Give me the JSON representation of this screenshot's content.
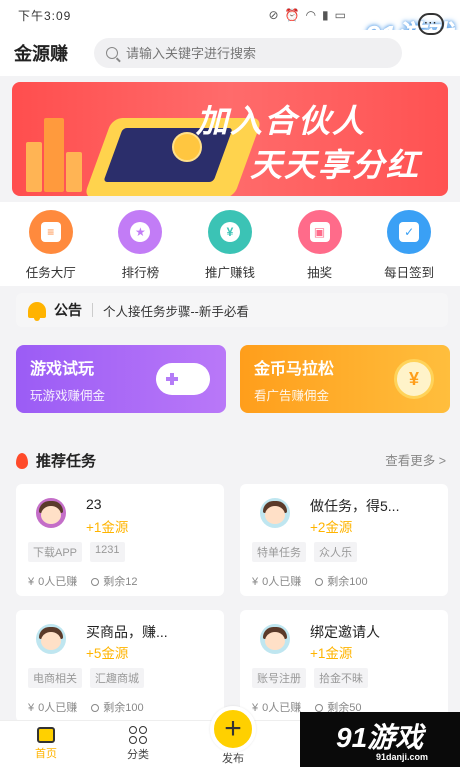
{
  "status_bar": {
    "time": "下午3:09"
  },
  "watermark": {
    "brand": "91游戏",
    "url": "91danji.com"
  },
  "header": {
    "app_title": "金源赚",
    "search_placeholder": "请输入关键字进行搜索"
  },
  "banner": {
    "line1": "加入合伙人",
    "line2": "天天享分红"
  },
  "quick_nav": [
    {
      "label": "任务大厅",
      "icon": "task-hall-icon",
      "color": "#ff8a3d"
    },
    {
      "label": "排行榜",
      "icon": "ranking-icon",
      "color": "#c27cf6"
    },
    {
      "label": "推广赚钱",
      "icon": "promote-money-icon",
      "color": "#3bc3b5"
    },
    {
      "label": "抽奖",
      "icon": "lottery-gift-icon",
      "color": "#ff6b8a"
    },
    {
      "label": "每日签到",
      "icon": "daily-checkin-icon",
      "color": "#3aa0f5"
    }
  ],
  "notice": {
    "title": "公告",
    "text": "个人接任务步骤--新手必看"
  },
  "promos": [
    {
      "title": "游戏试玩",
      "subtitle": "玩游戏赚佣金"
    },
    {
      "title": "金币马拉松",
      "subtitle": "看广告赚佣金"
    }
  ],
  "recommended": {
    "title": "推荐任务",
    "more": "查看更多 >",
    "tasks": [
      {
        "name": "23",
        "reward": "+1金源",
        "tags": [
          "下载APP",
          "1231"
        ],
        "done": "0人已赚",
        "remaining": "剩余12"
      },
      {
        "name": "做任务，得5...",
        "reward": "+2金源",
        "tags": [
          "特单任务",
          "众人乐"
        ],
        "done": "0人已赚",
        "remaining": "剩余100"
      },
      {
        "name": "买商品，赚...",
        "reward": "+5金源",
        "tags": [
          "电商相关",
          "汇趣商城"
        ],
        "done": "0人已赚",
        "remaining": "剩余100"
      },
      {
        "name": "绑定邀请人",
        "reward": "+1金源",
        "tags": [
          "账号注册",
          "拾金不昧"
        ],
        "done": "0人已赚",
        "remaining": "剩余50"
      }
    ]
  },
  "bottom_nav": {
    "home": "首页",
    "category": "分类",
    "publish": "发布"
  }
}
